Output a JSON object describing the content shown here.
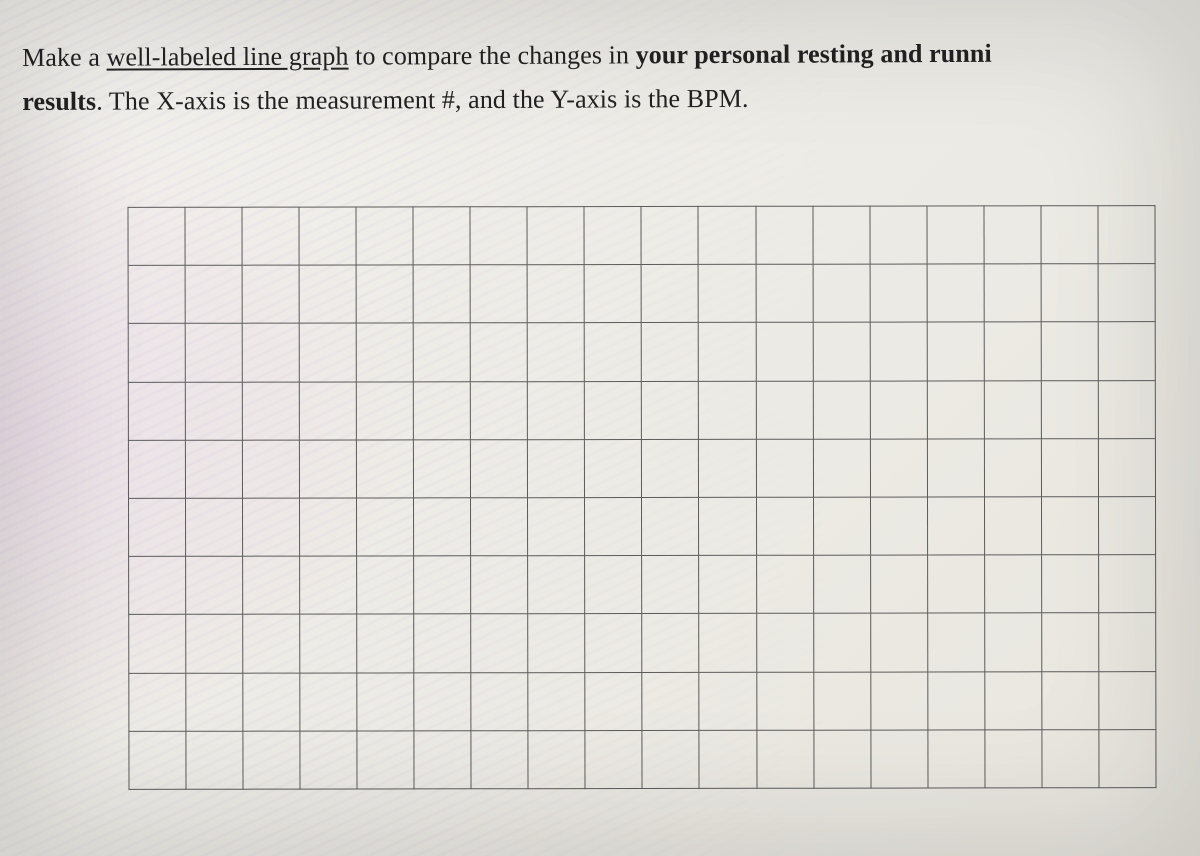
{
  "instructions": {
    "prefix": "Make a ",
    "underlined": "well-labeled line graph",
    "mid1": " to compare the changes in ",
    "bold1": "your personal resting and runni",
    "line2_bold": "results",
    "line2_rest": ".  The X-axis is the measurement #, and the Y-axis is the BPM."
  },
  "grid": {
    "rows": 10,
    "cols": 18
  }
}
